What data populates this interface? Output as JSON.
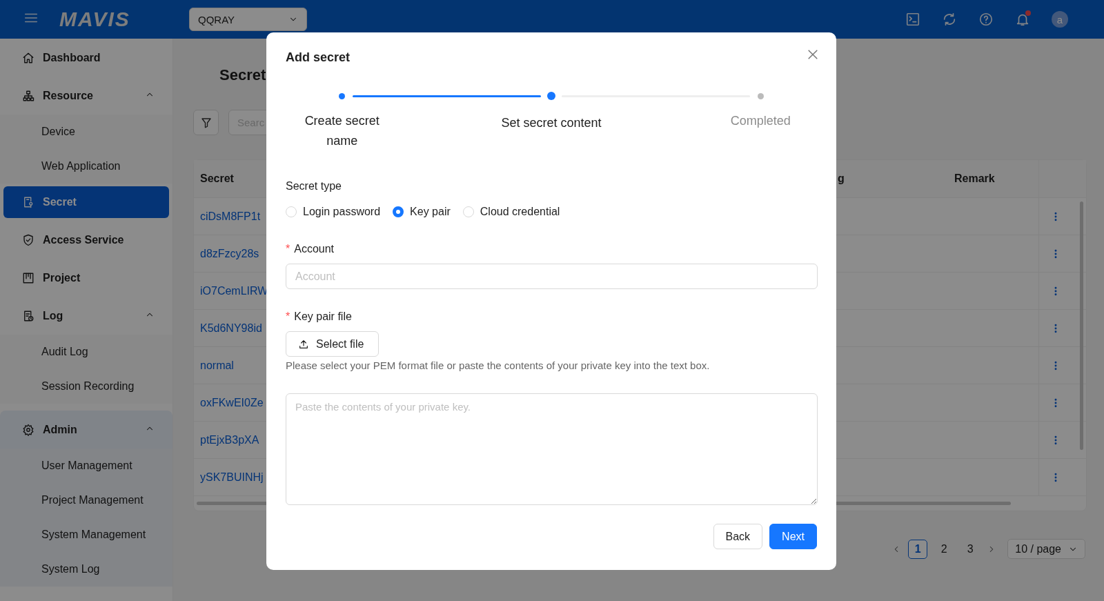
{
  "header": {
    "logo": "MAVIS",
    "project_select": {
      "value": "QQRAY"
    },
    "has_unread": true,
    "avatar": "a"
  },
  "sidebar": {
    "items": [
      {
        "label": "Dashboard",
        "selected": false
      },
      {
        "label": "Resource",
        "selected": false,
        "expanded": true,
        "children": [
          {
            "label": "Device",
            "selected": false
          },
          {
            "label": "Web Application",
            "selected": false
          }
        ]
      },
      {
        "label": "Secret",
        "selected": true
      },
      {
        "label": "Access Service",
        "selected": false
      },
      {
        "label": "Project",
        "selected": false
      },
      {
        "label": "Log",
        "selected": false,
        "expanded": true,
        "children": [
          {
            "label": "Audit Log",
            "selected": false
          },
          {
            "label": "Session Recording",
            "selected": false
          }
        ]
      },
      {
        "label": "Admin",
        "selected": false,
        "expanded": true,
        "hovered": true,
        "children": [
          {
            "label": "User Management",
            "selected": false
          },
          {
            "label": "Project Management",
            "selected": false
          },
          {
            "label": "System Management",
            "selected": false
          },
          {
            "label": "System Log",
            "selected": false
          }
        ]
      }
    ]
  },
  "page": {
    "title": "Secret",
    "search": {
      "placeholder": "Searc"
    },
    "table": {
      "columns": [
        "Secret",
        "g",
        "Remark"
      ],
      "rows": [
        {
          "secret": "ciDsM8FP1t"
        },
        {
          "secret": "d8zFzcy28s"
        },
        {
          "secret": "iO7CemLIRW"
        },
        {
          "secret": "K5d6NY98id"
        },
        {
          "secret": "normal"
        },
        {
          "secret": "oxFKwEI0Ze"
        },
        {
          "secret": "ptEjxB3pXA"
        },
        {
          "secret": "ySK7BUINHj"
        }
      ]
    },
    "pagination": {
      "pages": [
        {
          "label": "1",
          "selected": true
        },
        {
          "label": "2",
          "selected": false
        },
        {
          "label": "3",
          "selected": false
        }
      ],
      "page_size": "10 / page"
    }
  },
  "modal": {
    "title": "Add secret",
    "steps": [
      {
        "label": "Create secret name",
        "done": true,
        "current": false
      },
      {
        "label": "Set secret content",
        "done": false,
        "current": true
      },
      {
        "label": "Completed",
        "done": false,
        "current": false
      }
    ],
    "secret_type": {
      "label": "Secret type",
      "options": [
        {
          "label": "Login password",
          "selected": false
        },
        {
          "label": "Key pair",
          "selected": true
        },
        {
          "label": "Cloud credential",
          "selected": false
        }
      ]
    },
    "account": {
      "label": "Account",
      "required_mark": "*",
      "placeholder": "Account"
    },
    "key_file": {
      "label": "Key pair file",
      "required_mark": "*",
      "button": "Select file",
      "help": "Please select your PEM format file or paste the contents of your private key into the text box."
    },
    "private_key": {
      "placeholder": "Paste the contents of your private key."
    },
    "buttons": [
      {
        "label": "Back",
        "kind": "default"
      },
      {
        "label": "Next",
        "kind": "primary"
      }
    ]
  }
}
